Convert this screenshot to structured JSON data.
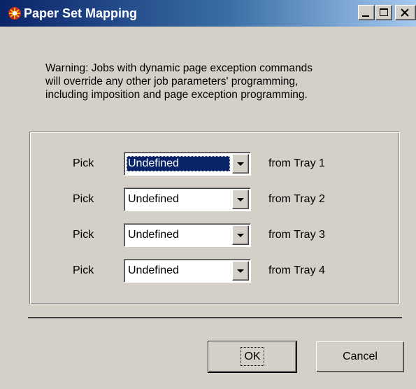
{
  "window": {
    "title": "Paper Set Mapping",
    "controls": {
      "minimize_icon": "minimize-icon",
      "maximize_icon": "maximize-icon",
      "close_icon": "close-icon"
    }
  },
  "warning": {
    "lines": [
      "Warning: Jobs with dynamic page exception commands",
      "will override any other job parameters' programming,",
      "including imposition and page exception programming."
    ]
  },
  "mappings": [
    {
      "pick_label": "Pick",
      "value": "Undefined",
      "tray_label": "from Tray 1",
      "selected": true
    },
    {
      "pick_label": "Pick",
      "value": "Undefined",
      "tray_label": "from Tray 2",
      "selected": false
    },
    {
      "pick_label": "Pick",
      "value": "Undefined",
      "tray_label": "from Tray 3",
      "selected": false
    },
    {
      "pick_label": "Pick",
      "value": "Undefined",
      "tray_label": "from Tray 4",
      "selected": false
    }
  ],
  "buttons": {
    "ok_label": "OK",
    "cancel_label": "Cancel"
  },
  "colors": {
    "titlebar_start": "#0a246a",
    "titlebar_end": "#a6caf0",
    "face": "#d4d0c8",
    "selection": "#0a246a"
  }
}
